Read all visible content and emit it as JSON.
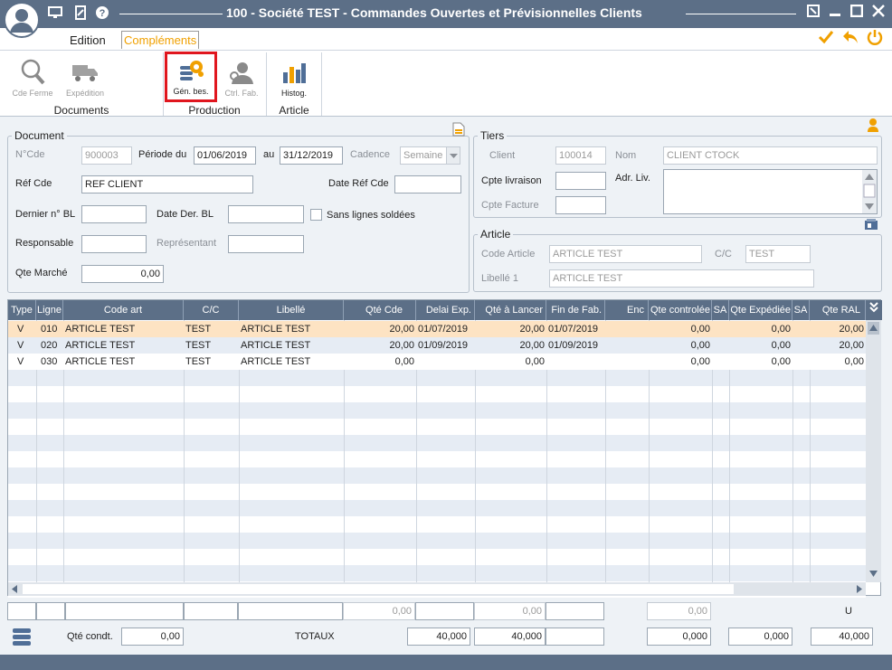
{
  "window": {
    "title": "100 - Société TEST -  Commandes Ouvertes et Prévisionnelles Clients"
  },
  "menu": {
    "tabs": [
      "Edition",
      "Compléments"
    ]
  },
  "ribbon": {
    "groups": {
      "documents": "Documents",
      "production": "Production",
      "article": "Article"
    },
    "buttons": {
      "cde_ferme": "Cde Ferme",
      "expedition": "Expédition",
      "gen_bes": "Gén. bes.",
      "ctrl_fab": "Ctrl. Fab.",
      "histog": "Histog."
    }
  },
  "document": {
    "legend": "Document",
    "ncde_label": "N°Cde",
    "ncde": "900003",
    "periode_label": "Période du",
    "periode_from": "01/06/2019",
    "au_label": "au",
    "periode_to": "31/12/2019",
    "cadence_label": "Cadence",
    "cadence": "Semaine",
    "ref_cde_label": "Réf Cde",
    "ref_cde": "REF CLIENT",
    "date_ref_label": "Date Réf Cde",
    "date_ref": "",
    "dernier_bl_label": "Dernier n° BL",
    "dernier_bl": "",
    "date_der_bl_label": "Date Der. BL",
    "date_der_bl": "",
    "sans_lignes_label": "Sans lignes soldées",
    "responsable_label": "Responsable",
    "responsable": "",
    "representant_label": "Représentant",
    "representant": "",
    "qte_marche_label": "Qte Marché",
    "qte_marche": "0,00"
  },
  "tiers": {
    "legend": "Tiers",
    "client_label": "Client",
    "client": "100014",
    "nom_label": "Nom",
    "nom": "CLIENT CTOCK",
    "cpte_liv_label": "Cpte livraison",
    "cpte_liv": "",
    "adr_liv_label": "Adr. Liv.",
    "cpte_fact_label": "Cpte Facture",
    "cpte_fact": ""
  },
  "article": {
    "legend": "Article",
    "code_label": "Code Article",
    "code": "ARTICLE TEST",
    "cc_label": "C/C",
    "cc": "TEST",
    "libelle_label": "Libellé 1",
    "libelle": "ARTICLE TEST"
  },
  "grid": {
    "headers": [
      "Type",
      "Ligne",
      "Code art",
      "C/C",
      "Libellé",
      "Qté Cde",
      "Delai Exp.",
      "Qté à Lancer",
      "Fin de Fab.",
      "Enc",
      "Qte controlée",
      "SA",
      "Qte Expédiée",
      "SA",
      "Qte RAL"
    ],
    "rows": [
      [
        "V",
        "010",
        "ARTICLE TEST",
        "TEST",
        "ARTICLE TEST",
        "20,00",
        "01/07/2019",
        "20,00",
        "01/07/2019",
        "",
        "0,00",
        "",
        "0,00",
        "",
        "20,00"
      ],
      [
        "V",
        "020",
        "ARTICLE TEST",
        "TEST",
        "ARTICLE TEST",
        "20,00",
        "01/09/2019",
        "20,00",
        "01/09/2019",
        "",
        "0,00",
        "",
        "0,00",
        "",
        "20,00"
      ],
      [
        "V",
        "030",
        "ARTICLE TEST",
        "TEST",
        "ARTICLE TEST",
        "0,00",
        "",
        "0,00",
        "",
        "",
        "0,00",
        "",
        "0,00",
        "",
        "0,00"
      ]
    ]
  },
  "summary": {
    "row1": {
      "qte_cde": "0,00",
      "qte_lancer": "0,00",
      "qte_ctrl": "0,00",
      "u": "U"
    },
    "qte_condt_label": "Qté condt.",
    "qte_condt": "0,00",
    "totaux_label": "TOTAUX",
    "tot_qte_cde": "40,000",
    "tot_qte_lancer": "40,000",
    "tot_qte_ctrl": "0,000",
    "tot_qte_exp": "0,000",
    "tot_qte_ral": "40,000"
  },
  "colors": {
    "titlebar": "#5c6f87",
    "selected_row": "#fde3c3",
    "highlight_box": "#e0161e",
    "accent": "#f0a000"
  }
}
